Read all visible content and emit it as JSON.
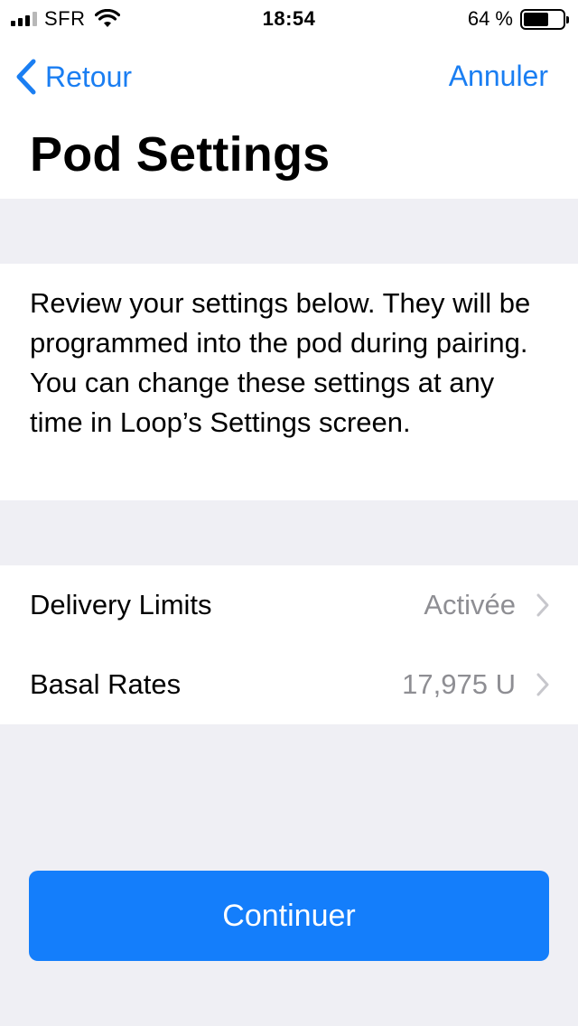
{
  "status_bar": {
    "carrier": "SFR",
    "time": "18:54",
    "battery_percent": "64 %",
    "battery_level": 0.64,
    "signal_bars": 3
  },
  "nav": {
    "back_label": "Retour",
    "cancel_label": "Annuler",
    "title": "Pod Settings"
  },
  "description": "Review your settings below. They will be programmed into the pod during pairing. You can change these settings at any time in Loop’s Settings screen.",
  "settings": [
    {
      "label": "Delivery Limits",
      "value": "Activée"
    },
    {
      "label": "Basal Rates",
      "value": "17,975 U"
    }
  ],
  "continue_label": "Continuer",
  "colors": {
    "accent": "#147efb",
    "background": "#efeff4",
    "secondary_text": "#8e8e93"
  }
}
